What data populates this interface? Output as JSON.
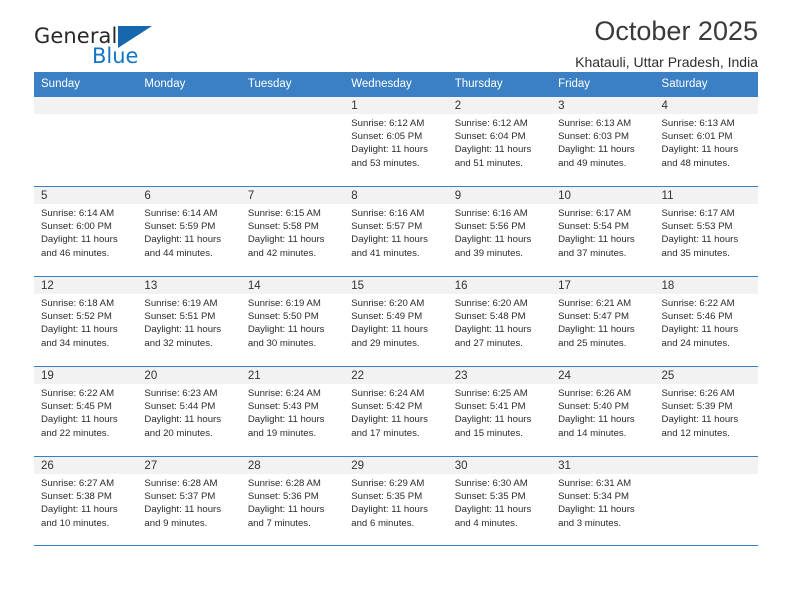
{
  "brand": {
    "name_top": "General",
    "name_bottom": "Blue",
    "accent_color": "#1667ad",
    "blue_text_color": "#1277c4"
  },
  "header": {
    "title": "October 2025",
    "location": "Khatauli, Uttar Pradesh, India"
  },
  "calendar": {
    "header_bg": "#3b80c4",
    "datebar_bg": "#f2f2f2",
    "weekdays": [
      "Sunday",
      "Monday",
      "Tuesday",
      "Wednesday",
      "Thursday",
      "Friday",
      "Saturday"
    ],
    "weeks": [
      [
        {
          "day": "",
          "lines": []
        },
        {
          "day": "",
          "lines": []
        },
        {
          "day": "",
          "lines": []
        },
        {
          "day": "1",
          "lines": [
            "Sunrise: 6:12 AM",
            "Sunset: 6:05 PM",
            "Daylight: 11 hours",
            "and 53 minutes."
          ]
        },
        {
          "day": "2",
          "lines": [
            "Sunrise: 6:12 AM",
            "Sunset: 6:04 PM",
            "Daylight: 11 hours",
            "and 51 minutes."
          ]
        },
        {
          "day": "3",
          "lines": [
            "Sunrise: 6:13 AM",
            "Sunset: 6:03 PM",
            "Daylight: 11 hours",
            "and 49 minutes."
          ]
        },
        {
          "day": "4",
          "lines": [
            "Sunrise: 6:13 AM",
            "Sunset: 6:01 PM",
            "Daylight: 11 hours",
            "and 48 minutes."
          ]
        }
      ],
      [
        {
          "day": "5",
          "lines": [
            "Sunrise: 6:14 AM",
            "Sunset: 6:00 PM",
            "Daylight: 11 hours",
            "and 46 minutes."
          ]
        },
        {
          "day": "6",
          "lines": [
            "Sunrise: 6:14 AM",
            "Sunset: 5:59 PM",
            "Daylight: 11 hours",
            "and 44 minutes."
          ]
        },
        {
          "day": "7",
          "lines": [
            "Sunrise: 6:15 AM",
            "Sunset: 5:58 PM",
            "Daylight: 11 hours",
            "and 42 minutes."
          ]
        },
        {
          "day": "8",
          "lines": [
            "Sunrise: 6:16 AM",
            "Sunset: 5:57 PM",
            "Daylight: 11 hours",
            "and 41 minutes."
          ]
        },
        {
          "day": "9",
          "lines": [
            "Sunrise: 6:16 AM",
            "Sunset: 5:56 PM",
            "Daylight: 11 hours",
            "and 39 minutes."
          ]
        },
        {
          "day": "10",
          "lines": [
            "Sunrise: 6:17 AM",
            "Sunset: 5:54 PM",
            "Daylight: 11 hours",
            "and 37 minutes."
          ]
        },
        {
          "day": "11",
          "lines": [
            "Sunrise: 6:17 AM",
            "Sunset: 5:53 PM",
            "Daylight: 11 hours",
            "and 35 minutes."
          ]
        }
      ],
      [
        {
          "day": "12",
          "lines": [
            "Sunrise: 6:18 AM",
            "Sunset: 5:52 PM",
            "Daylight: 11 hours",
            "and 34 minutes."
          ]
        },
        {
          "day": "13",
          "lines": [
            "Sunrise: 6:19 AM",
            "Sunset: 5:51 PM",
            "Daylight: 11 hours",
            "and 32 minutes."
          ]
        },
        {
          "day": "14",
          "lines": [
            "Sunrise: 6:19 AM",
            "Sunset: 5:50 PM",
            "Daylight: 11 hours",
            "and 30 minutes."
          ]
        },
        {
          "day": "15",
          "lines": [
            "Sunrise: 6:20 AM",
            "Sunset: 5:49 PM",
            "Daylight: 11 hours",
            "and 29 minutes."
          ]
        },
        {
          "day": "16",
          "lines": [
            "Sunrise: 6:20 AM",
            "Sunset: 5:48 PM",
            "Daylight: 11 hours",
            "and 27 minutes."
          ]
        },
        {
          "day": "17",
          "lines": [
            "Sunrise: 6:21 AM",
            "Sunset: 5:47 PM",
            "Daylight: 11 hours",
            "and 25 minutes."
          ]
        },
        {
          "day": "18",
          "lines": [
            "Sunrise: 6:22 AM",
            "Sunset: 5:46 PM",
            "Daylight: 11 hours",
            "and 24 minutes."
          ]
        }
      ],
      [
        {
          "day": "19",
          "lines": [
            "Sunrise: 6:22 AM",
            "Sunset: 5:45 PM",
            "Daylight: 11 hours",
            "and 22 minutes."
          ]
        },
        {
          "day": "20",
          "lines": [
            "Sunrise: 6:23 AM",
            "Sunset: 5:44 PM",
            "Daylight: 11 hours",
            "and 20 minutes."
          ]
        },
        {
          "day": "21",
          "lines": [
            "Sunrise: 6:24 AM",
            "Sunset: 5:43 PM",
            "Daylight: 11 hours",
            "and 19 minutes."
          ]
        },
        {
          "day": "22",
          "lines": [
            "Sunrise: 6:24 AM",
            "Sunset: 5:42 PM",
            "Daylight: 11 hours",
            "and 17 minutes."
          ]
        },
        {
          "day": "23",
          "lines": [
            "Sunrise: 6:25 AM",
            "Sunset: 5:41 PM",
            "Daylight: 11 hours",
            "and 15 minutes."
          ]
        },
        {
          "day": "24",
          "lines": [
            "Sunrise: 6:26 AM",
            "Sunset: 5:40 PM",
            "Daylight: 11 hours",
            "and 14 minutes."
          ]
        },
        {
          "day": "25",
          "lines": [
            "Sunrise: 6:26 AM",
            "Sunset: 5:39 PM",
            "Daylight: 11 hours",
            "and 12 minutes."
          ]
        }
      ],
      [
        {
          "day": "26",
          "lines": [
            "Sunrise: 6:27 AM",
            "Sunset: 5:38 PM",
            "Daylight: 11 hours",
            "and 10 minutes."
          ]
        },
        {
          "day": "27",
          "lines": [
            "Sunrise: 6:28 AM",
            "Sunset: 5:37 PM",
            "Daylight: 11 hours",
            "and 9 minutes."
          ]
        },
        {
          "day": "28",
          "lines": [
            "Sunrise: 6:28 AM",
            "Sunset: 5:36 PM",
            "Daylight: 11 hours",
            "and 7 minutes."
          ]
        },
        {
          "day": "29",
          "lines": [
            "Sunrise: 6:29 AM",
            "Sunset: 5:35 PM",
            "Daylight: 11 hours",
            "and 6 minutes."
          ]
        },
        {
          "day": "30",
          "lines": [
            "Sunrise: 6:30 AM",
            "Sunset: 5:35 PM",
            "Daylight: 11 hours",
            "and 4 minutes."
          ]
        },
        {
          "day": "31",
          "lines": [
            "Sunrise: 6:31 AM",
            "Sunset: 5:34 PM",
            "Daylight: 11 hours",
            "and 3 minutes."
          ]
        },
        {
          "day": "",
          "lines": []
        }
      ]
    ]
  }
}
